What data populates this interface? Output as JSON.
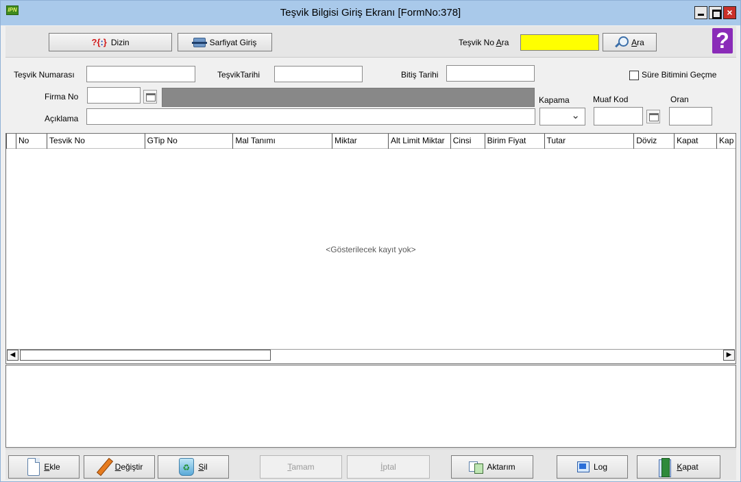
{
  "window": {
    "title": "Teşvik Bilgisi Giriş Ekranı [FormNo:378]",
    "app_icon_text": "IPN"
  },
  "toolbar": {
    "dizin_label": "Dizin",
    "sarfiyat_label": "Sarfiyat Giriş",
    "tesvik_no_ara_prefix": "Teşvik No ",
    "tesvik_no_ara_underlined": "A",
    "tesvik_no_ara_suffix": "ra",
    "search_value": "",
    "ara_underlined": "A",
    "ara_rest": "ra",
    "help_label": "?"
  },
  "form": {
    "tesvik_numarasi_label": "Teşvik Numarası",
    "tesvik_numarasi_value": "",
    "tesvik_tarihi_label": "TeşvikTarihi",
    "tesvik_tarihi_value": "",
    "bitis_tarihi_label": "Bitiş Tarihi",
    "bitis_tarihi_value": "",
    "sure_bitimi_label": "Süre Bitimini Geçme",
    "sure_bitimi_checked": false,
    "firma_no_label": "Firma No",
    "firma_no_value": "",
    "firma_name_value": "",
    "kapama_label": "Kapama",
    "kapama_value": "",
    "muaf_kod_label": "Muaf Kod",
    "muaf_kod_value": "",
    "oran_label": "Oran",
    "oran_value": "",
    "aciklama_label": "Açıklama",
    "aciklama_value": ""
  },
  "grid": {
    "columns": [
      "",
      "No",
      "Tesvik No",
      "GTip No",
      "Mal Tanımı",
      "Miktar",
      "Alt Limit Miktar",
      "Cinsi",
      "Birim Fiyat",
      "Tutar",
      "Döviz",
      "Kapat",
      "Kap"
    ],
    "empty_message": "<Gösterilecek kayıt yok>",
    "rows": []
  },
  "bottom": {
    "ekle_u": "E",
    "ekle_rest": "kle",
    "degistir_u": "D",
    "degistir_rest": "eğiştir",
    "sil_u": "S",
    "sil_rest": "il",
    "tamam_u": "T",
    "tamam_rest": "amam",
    "iptal_u": "İ",
    "iptal_rest": "ptal",
    "aktarim_label": "Aktarım",
    "log_label": "Log",
    "kapat_u": "K",
    "kapat_rest": "apat"
  },
  "colors": {
    "titlebar": "#a9c9ea",
    "search_highlight": "#ffff00",
    "help_purple": "#8a2bb8",
    "firma_name_field": "#888888"
  }
}
